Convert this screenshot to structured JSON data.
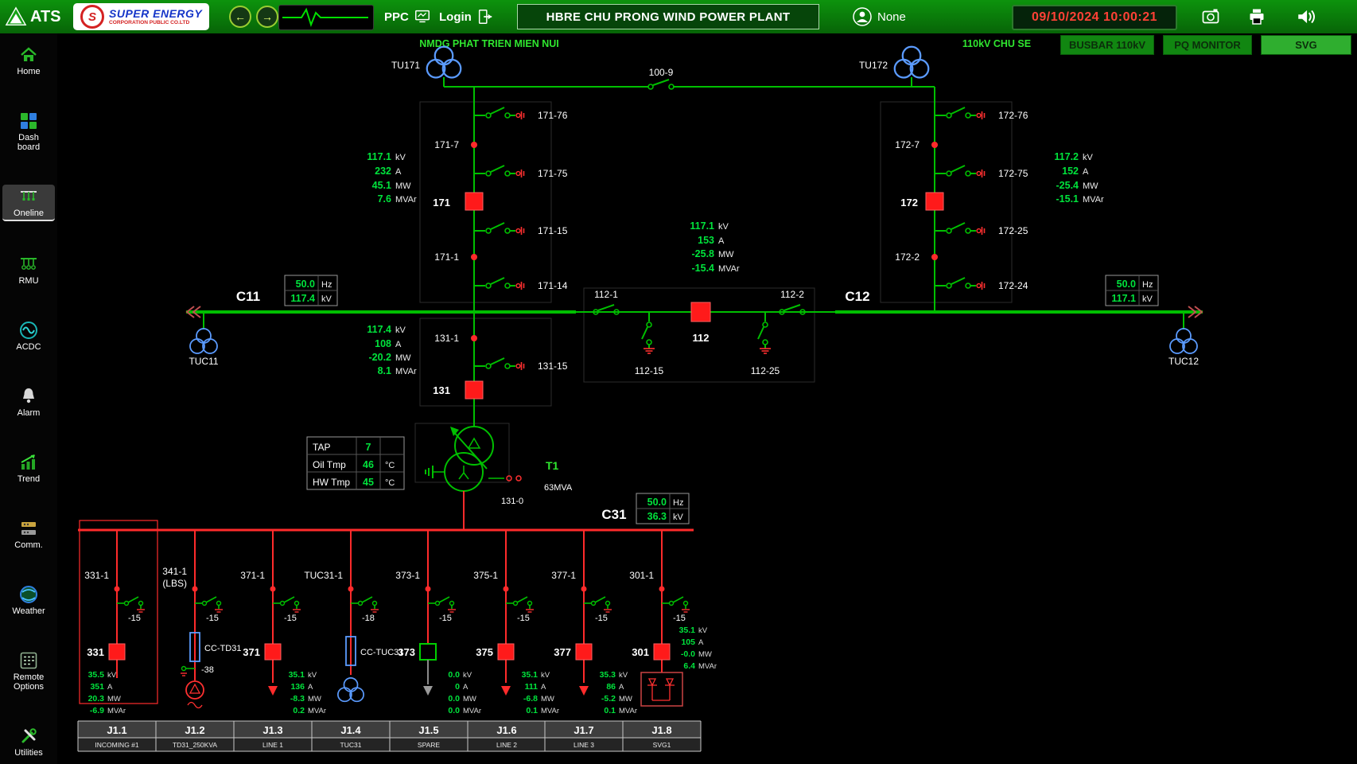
{
  "header": {
    "ats": "ATS",
    "super_s": "S",
    "super1": "SUPER ENERGY",
    "super2": "CORPORATION PUBLIC CO.LTD",
    "ppc": "PPC",
    "login": "Login",
    "title": "HBRE CHU PRONG WIND POWER PLANT",
    "user": "None",
    "datetime": "09/10/2024 10:00:21"
  },
  "tabs": {
    "busbar": "BUSBAR 110kV",
    "pq": "PQ MONITOR",
    "svg": "SVG"
  },
  "sidebar": {
    "home": "Home",
    "dashboard": "Dash board",
    "oneline": "Oneline",
    "rmu": "RMU",
    "acdc": "ACDC",
    "alarm": "Alarm",
    "trend": "Trend",
    "comm": "Comm.",
    "weather": "Weather",
    "remote": "Remote Options",
    "utilities": "Utilities"
  },
  "diagram": {
    "src_left": "NMDG PHAT TRIEN MIEN NUI",
    "src_right": "110kV CHU SE",
    "tu171": "TU171",
    "tu172": "TU172",
    "d1009": "100-9",
    "f171": {
      "d76": "171-76",
      "d7": "171-7",
      "d75": "171-75",
      "brk": "171",
      "d15": "171-15",
      "d1": "171-1",
      "d14": "171-14",
      "kv": "117.1",
      "kvu": "kV",
      "a": "232",
      "au": "A",
      "mw": "45.1",
      "mwu": "MW",
      "mvar": "7.6",
      "mvaru": "MVAr"
    },
    "f172": {
      "d76": "172-76",
      "d7": "172-7",
      "d75": "172-75",
      "brk": "172",
      "d25": "172-25",
      "d2": "172-2",
      "d24": "172-24",
      "kv": "117.2",
      "kvu": "kV",
      "a": "152",
      "au": "A",
      "mw": "-25.4",
      "mwu": "MW",
      "mvar": "-15.1",
      "mvaru": "MVAr"
    },
    "tie112": {
      "d1": "112-1",
      "brk": "112",
      "d2": "112-2",
      "d15": "112-15",
      "d25": "112-25",
      "kv": "117.1",
      "kvu": "kV",
      "a": "153",
      "au": "A",
      "mw": "-25.8",
      "mwu": "MW",
      "mvar": "-15.4",
      "mvaru": "MVAr"
    },
    "c11": {
      "name": "C11",
      "hz": "50.0",
      "hzu": "Hz",
      "kv": "117.4",
      "kvu": "kV"
    },
    "c12": {
      "name": "C12",
      "hz": "50.0",
      "hzu": "Hz",
      "kv": "117.1",
      "kvu": "kV"
    },
    "c31": {
      "name": "C31",
      "hz": "50.0",
      "hzu": "Hz",
      "kv": "36.3",
      "kvu": "kV"
    },
    "tuc11": "TUC11",
    "tuc12": "TUC12",
    "f131": {
      "d1": "131-1",
      "d15": "131-15",
      "brk": "131",
      "kv": "117.4",
      "kvu": "kV",
      "a": "108",
      "au": "A",
      "mw": "-20.2",
      "mwu": "MW",
      "mvar": "8.1",
      "mvaru": "MVAr"
    },
    "t1": {
      "name": "T1",
      "mva": "63MVA",
      "d0": "131-0",
      "tap_label": "TAP",
      "tap": "7",
      "oil_label": "Oil Tmp",
      "oil": "46",
      "oilu": "°C",
      "hw_label": "HW Tmp",
      "hw": "45",
      "hwu": "°C"
    },
    "bays": [
      {
        "iso": "331-1",
        "es": "-15",
        "brk": "331",
        "kv": "35.5",
        "kvu": "kV",
        "a": "351",
        "au": "A",
        "mw": "20.3",
        "mwu": "MW",
        "mvar": "-6.9",
        "mvaru": "MVAr",
        "j": "J1.1",
        "desc": "INCOMING #1"
      },
      {
        "iso": "341-1",
        "iso2": "(LBS)",
        "es": "-15",
        "cc": "CC-TD31",
        "es2": "-38",
        "j": "J1.2",
        "desc": "TD31_250KVA"
      },
      {
        "iso": "371-1",
        "es": "-15",
        "brk": "371",
        "kv": "35.1",
        "kvu": "kV",
        "a": "136",
        "au": "A",
        "mw": "-8.3",
        "mwu": "MW",
        "mvar": "0.2",
        "mvaru": "MVAr",
        "j": "J1.3",
        "desc": "LINE 1"
      },
      {
        "iso": "TUC31-1",
        "es": "-18",
        "cc": "CC-TUC31",
        "j": "J1.4",
        "desc": "TUC31"
      },
      {
        "iso": "373-1",
        "es": "-15",
        "brk": "373",
        "kv": "0.0",
        "kvu": "kV",
        "a": "0",
        "au": "A",
        "mw": "0.0",
        "mwu": "MW",
        "mvar": "0.0",
        "mvaru": "MVAr",
        "j": "J1.5",
        "desc": "SPARE"
      },
      {
        "iso": "375-1",
        "es": "-15",
        "brk": "375",
        "kv": "35.1",
        "kvu": "kV",
        "a": "111",
        "au": "A",
        "mw": "-6.8",
        "mwu": "MW",
        "mvar": "0.1",
        "mvaru": "MVAr",
        "j": "J1.6",
        "desc": "LINE 2"
      },
      {
        "iso": "377-1",
        "es": "-15",
        "brk": "377",
        "kv": "35.3",
        "kvu": "kV",
        "a": "86",
        "au": "A",
        "mw": "-5.2",
        "mwu": "MW",
        "mvar": "0.1",
        "mvaru": "MVAr",
        "j": "J1.7",
        "desc": "LINE 3"
      },
      {
        "iso": "301-1",
        "es": "-15",
        "brk": "301",
        "kv": "35.1",
        "kvu": "kV",
        "a": "105",
        "au": "A",
        "mw": "-0.0",
        "mwu": "MW",
        "mvar": "6.4",
        "mvaru": "MVAr",
        "j": "J1.8",
        "desc": "SVG1"
      }
    ]
  }
}
